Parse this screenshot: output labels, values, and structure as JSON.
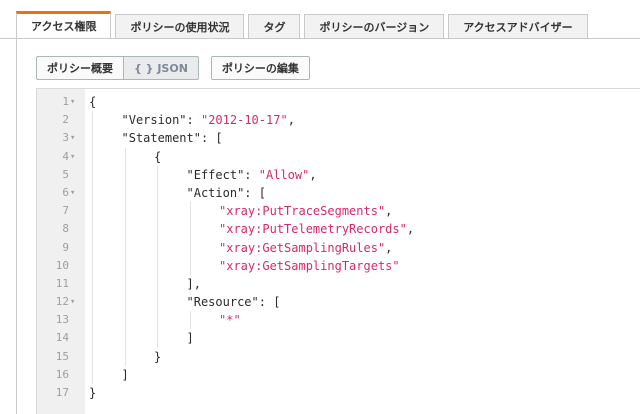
{
  "tabs": [
    {
      "label": "アクセス権限",
      "active": true
    },
    {
      "label": "ポリシーの使用状況",
      "active": false
    },
    {
      "label": "タグ",
      "active": false
    },
    {
      "label": "ポリシーのバージョン",
      "active": false
    },
    {
      "label": "アクセスアドバイザー",
      "active": false
    }
  ],
  "view_toggle": {
    "summary_label": "ポリシー概要",
    "json_label": "{ } JSON",
    "selected": "json"
  },
  "edit_button_label": "ポリシーの編集",
  "accent_color": "#ec7211",
  "string_color": "#d62a6a",
  "editor": {
    "lines": [
      {
        "n": "1",
        "fold": true,
        "indent": 0,
        "parts": [
          {
            "t": "{",
            "c": "p"
          }
        ]
      },
      {
        "n": "2",
        "fold": false,
        "indent": 1,
        "parts": [
          {
            "t": "\"Version\"",
            "c": "k"
          },
          {
            "t": ": ",
            "c": "p"
          },
          {
            "t": "\"2012-10-17\"",
            "c": "s"
          },
          {
            "t": ",",
            "c": "p"
          }
        ]
      },
      {
        "n": "3",
        "fold": true,
        "indent": 1,
        "parts": [
          {
            "t": "\"Statement\"",
            "c": "k"
          },
          {
            "t": ": [",
            "c": "p"
          }
        ]
      },
      {
        "n": "4",
        "fold": true,
        "indent": 2,
        "parts": [
          {
            "t": "{",
            "c": "p"
          }
        ]
      },
      {
        "n": "5",
        "fold": false,
        "indent": 3,
        "parts": [
          {
            "t": "\"Effect\"",
            "c": "k"
          },
          {
            "t": ": ",
            "c": "p"
          },
          {
            "t": "\"Allow\"",
            "c": "s"
          },
          {
            "t": ",",
            "c": "p"
          }
        ]
      },
      {
        "n": "6",
        "fold": true,
        "indent": 3,
        "parts": [
          {
            "t": "\"Action\"",
            "c": "k"
          },
          {
            "t": ": [",
            "c": "p"
          }
        ]
      },
      {
        "n": "7",
        "fold": false,
        "indent": 4,
        "parts": [
          {
            "t": "\"xray:PutTraceSegments\"",
            "c": "s"
          },
          {
            "t": ",",
            "c": "p"
          }
        ]
      },
      {
        "n": "8",
        "fold": false,
        "indent": 4,
        "parts": [
          {
            "t": "\"xray:PutTelemetryRecords\"",
            "c": "s"
          },
          {
            "t": ",",
            "c": "p"
          }
        ]
      },
      {
        "n": "9",
        "fold": false,
        "indent": 4,
        "parts": [
          {
            "t": "\"xray:GetSamplingRules\"",
            "c": "s"
          },
          {
            "t": ",",
            "c": "p"
          }
        ]
      },
      {
        "n": "10",
        "fold": false,
        "indent": 4,
        "parts": [
          {
            "t": "\"xray:GetSamplingTargets\"",
            "c": "s"
          }
        ]
      },
      {
        "n": "11",
        "fold": false,
        "indent": 3,
        "parts": [
          {
            "t": "],",
            "c": "p"
          }
        ]
      },
      {
        "n": "12",
        "fold": true,
        "indent": 3,
        "parts": [
          {
            "t": "\"Resource\"",
            "c": "k"
          },
          {
            "t": ": [",
            "c": "p"
          }
        ]
      },
      {
        "n": "13",
        "fold": false,
        "indent": 4,
        "parts": [
          {
            "t": "\"*\"",
            "c": "s"
          }
        ]
      },
      {
        "n": "14",
        "fold": false,
        "indent": 3,
        "parts": [
          {
            "t": "]",
            "c": "p"
          }
        ]
      },
      {
        "n": "15",
        "fold": false,
        "indent": 2,
        "parts": [
          {
            "t": "}",
            "c": "p"
          }
        ]
      },
      {
        "n": "16",
        "fold": false,
        "indent": 1,
        "parts": [
          {
            "t": "]",
            "c": "p"
          }
        ]
      },
      {
        "n": "17",
        "fold": false,
        "indent": 0,
        "parts": [
          {
            "t": "}",
            "c": "p"
          }
        ]
      }
    ]
  }
}
